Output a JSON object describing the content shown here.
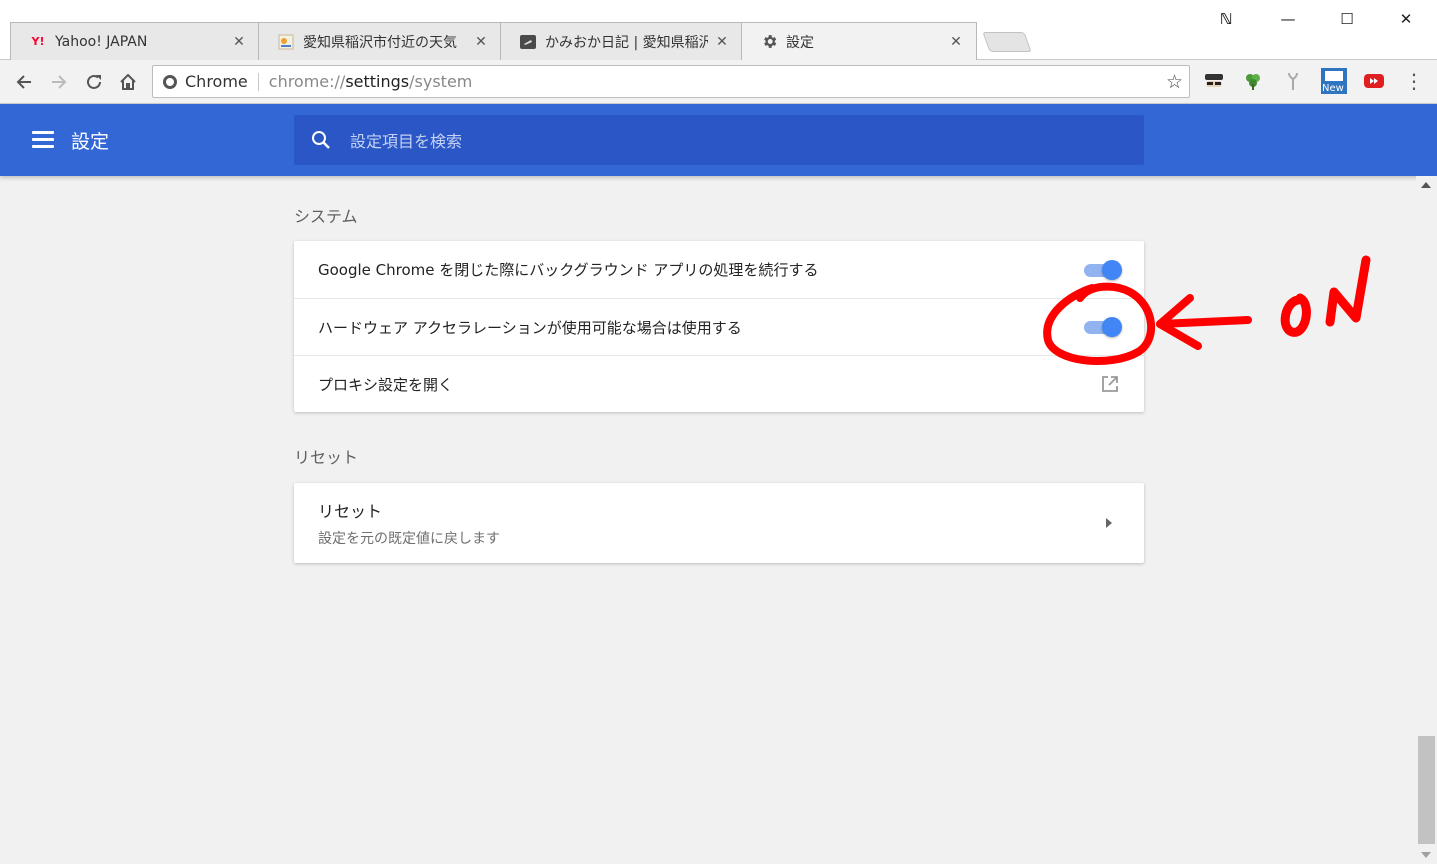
{
  "tabs": [
    {
      "title": "Yahoo! JAPAN",
      "favicon": "yahoo-icon",
      "favicon_text": "Y!",
      "favicon_color": "#ff0033"
    },
    {
      "title": "愛知県稲沢市付近の天気",
      "favicon": "weather-icon"
    },
    {
      "title": "かみおか日記 | 愛知県稲沢",
      "favicon": "blog-icon"
    },
    {
      "title": "設定",
      "favicon": "gear-icon"
    }
  ],
  "window": {
    "profile_label": "ℕ",
    "minimize": "—",
    "maximize": "☐",
    "close": "✕"
  },
  "toolbar": {
    "chip_label": "Chrome",
    "url_scheme": "chrome://",
    "url_host": "settings",
    "url_path": "/system",
    "extension_new_badge": "New"
  },
  "header": {
    "title": "設定",
    "search_placeholder": "設定項目を検索"
  },
  "sections": {
    "system": {
      "title": "システム",
      "rows": [
        {
          "label": "Google Chrome を閉じた際にバックグラウンド アプリの処理を続行する",
          "enabled": true
        },
        {
          "label": "ハードウェア アクセラレーションが使用可能な場合は使用する",
          "enabled": true
        },
        {
          "label": "プロキシ設定を開く"
        }
      ]
    },
    "reset": {
      "title": "リセット",
      "item_title": "リセット",
      "item_subtitle": "設定を元の既定値に戻します"
    }
  },
  "annotation": {
    "text": "ON",
    "color": "#ff0000"
  },
  "colors": {
    "header_blue": "#3367d6",
    "toggle_blue": "#4285f4"
  }
}
